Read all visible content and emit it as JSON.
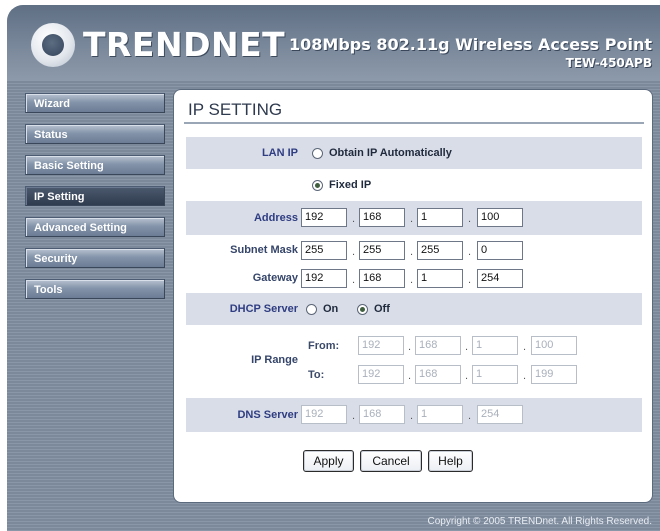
{
  "header": {
    "logo_text": "TRENDNET",
    "product_name": "108Mbps 802.11g Wireless Access Point",
    "model": "TEW-450APB"
  },
  "nav": {
    "items": [
      {
        "label": "Wizard"
      },
      {
        "label": "Status"
      },
      {
        "label": "Basic Setting"
      },
      {
        "label": "IP Setting"
      },
      {
        "label": "Advanced Setting"
      },
      {
        "label": "Security"
      },
      {
        "label": "Tools"
      }
    ],
    "active": "IP Setting"
  },
  "page": {
    "title": "IP SETTING"
  },
  "lan_ip": {
    "label": "LAN IP",
    "auto_label": "Obtain IP Automatically",
    "fixed_label": "Fixed IP",
    "selected": "Fixed IP"
  },
  "address": {
    "label": "Address",
    "octets": [
      "192",
      "168",
      "1",
      "100"
    ]
  },
  "subnet": {
    "label": "Subnet Mask",
    "octets": [
      "255",
      "255",
      "255",
      "0"
    ]
  },
  "gateway": {
    "label": "Gateway",
    "octets": [
      "192",
      "168",
      "1",
      "254"
    ]
  },
  "dhcp": {
    "label": "DHCP Server",
    "on_label": "On",
    "off_label": "Off",
    "selected": "Off"
  },
  "ip_range": {
    "label": "IP Range",
    "from_label": "From:",
    "to_label": "To:",
    "from": [
      "192",
      "168",
      "1",
      "100"
    ],
    "to": [
      "192",
      "168",
      "1",
      "199"
    ]
  },
  "dns": {
    "label": "DNS Server",
    "octets": [
      "192",
      "168",
      "1",
      "254"
    ]
  },
  "buttons": {
    "apply": "Apply",
    "cancel": "Cancel",
    "help": "Help"
  },
  "footer": {
    "copyright": "Copyright © 2005 TRENDnet. All Rights Reserved."
  },
  "colors": {
    "frame": "#7c899b",
    "nav_active": "#2f3b4e",
    "label_blue": "#2f3d82",
    "row_shade": "#d9dde7"
  }
}
